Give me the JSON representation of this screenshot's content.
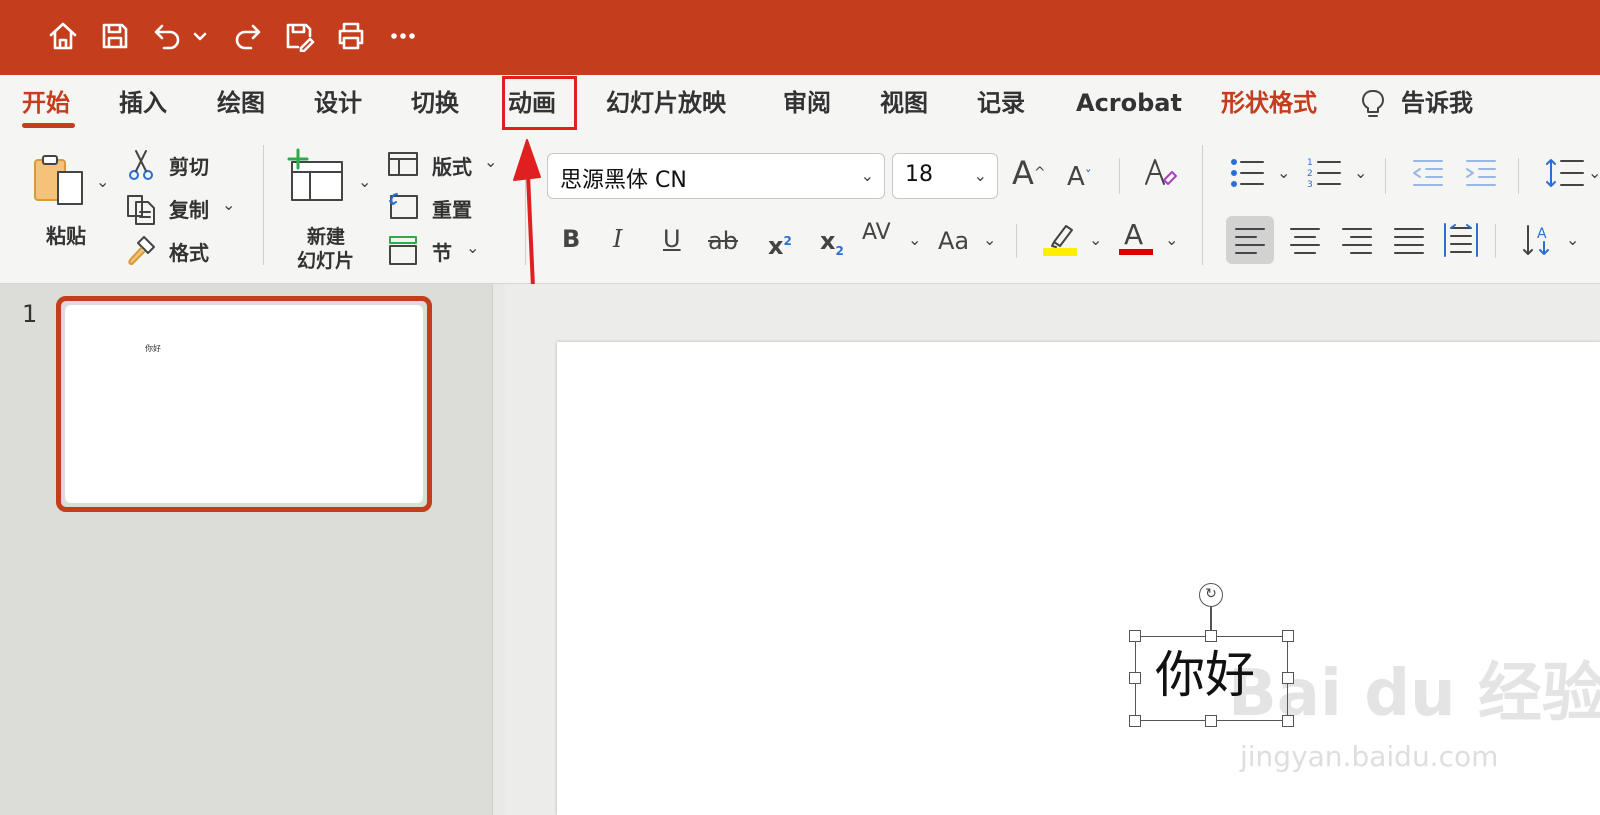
{
  "quick_access": [
    "home-icon",
    "save-icon",
    "undo-icon",
    "undo-dropdown-icon",
    "redo-icon",
    "save-as-icon",
    "print-icon",
    "more-icon"
  ],
  "tabs": [
    {
      "label": "开始"
    },
    {
      "label": "插入"
    },
    {
      "label": "绘图"
    },
    {
      "label": "设计"
    },
    {
      "label": "切换"
    },
    {
      "label": "动画"
    },
    {
      "label": "幻灯片放映"
    },
    {
      "label": "审阅"
    },
    {
      "label": "视图"
    },
    {
      "label": "记录"
    },
    {
      "label": "Acrobat"
    },
    {
      "label": "形状格式"
    },
    {
      "label": "告诉我"
    }
  ],
  "clipboard": {
    "paste": "粘贴",
    "cut": "剪切",
    "copy": "复制",
    "format": "格式"
  },
  "slides": {
    "new_slide_line1": "新建",
    "new_slide_line2": "幻灯片",
    "layout": "版式",
    "reset": "重置",
    "section": "节"
  },
  "font": {
    "name": "思源黑体 CN",
    "size": "18"
  },
  "format_buttons": {
    "bold": "B",
    "italic": "I",
    "underline": "U",
    "strike": "ab",
    "superscript": "x",
    "sup_mark": "2",
    "subscript": "x",
    "sub_mark": "2",
    "spacing": "AV",
    "case": "Aa",
    "grow": "A",
    "shrink": "A",
    "font_color": "A"
  },
  "colors": {
    "accent": "#c43d1c",
    "highlight": "#ffee00",
    "font_color": "#e00000",
    "callout": "#e02020"
  },
  "thumbnail": {
    "number": "1",
    "text": "你好"
  },
  "slide": {
    "textbox": "你好"
  },
  "watermark": {
    "brand": "Bai du 经验",
    "url": "jingyan.baidu.com"
  }
}
